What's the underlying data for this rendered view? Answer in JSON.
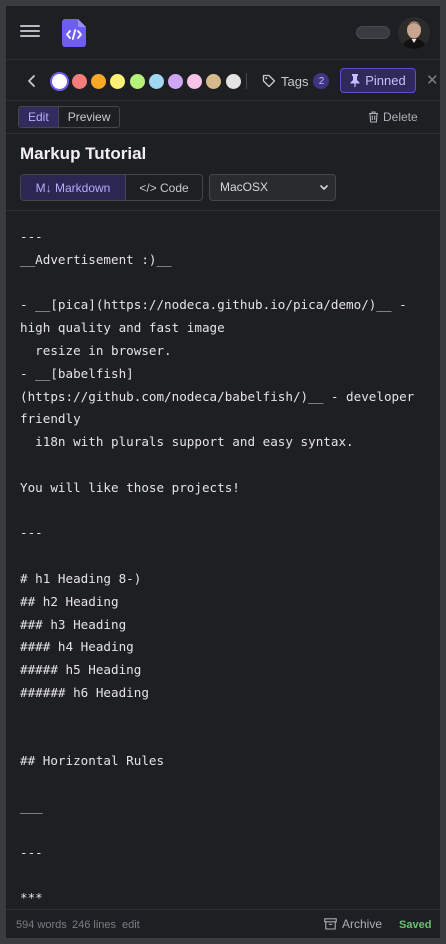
{
  "header": {
    "menu_icon": "hamburger-menu-icon",
    "logo_icon": "code-file-logo-icon",
    "avatar_icon": "user-avatar",
    "theme_toggle_icon": "toggle-switch"
  },
  "toolbar": {
    "back_icon": "chevron-left-icon",
    "colors": [
      "#ffffff",
      "#f47c7c",
      "#f9a825",
      "#fff176",
      "#b5f27a",
      "#9fd8f0",
      "#cfa6f5",
      "#f6c3e6",
      "#d7b98e",
      "#e4e4e4"
    ],
    "selected_color_index": 0,
    "tags_label": "Tags",
    "tags_count": "2",
    "pinned_label": "Pinned",
    "close_label": "✕"
  },
  "editbar": {
    "edit_label": "Edit",
    "preview_label": "Preview",
    "delete_label": "Delete"
  },
  "note": {
    "title": "Markup Tutorial",
    "markdown_label": "M↓ Markdown",
    "code_label": "</> Code",
    "language": "MacOSX"
  },
  "editor": {
    "content": "---\n__Advertisement :)__\n\n- __[pica](https://nodeca.github.io/pica/demo/)__ -\nhigh quality and fast image\n  resize in browser.\n- __[babelfish]\n(https://github.com/nodeca/babelfish/)__ - developer\nfriendly\n  i18n with plurals support and easy syntax.\n\nYou will like those projects!\n\n---\n\n# h1 Heading 8-)\n## h2 Heading\n### h3 Heading\n#### h4 Heading\n##### h5 Heading\n###### h6 Heading\n\n\n## Horizontal Rules\n\n___\n\n---\n\n***"
  },
  "status": {
    "words": "594 words",
    "lines": "246 lines",
    "mode": "edit",
    "archive_label": "Archive",
    "saved_label": "Saved"
  },
  "colors": {
    "accent": "#6d5df0",
    "background": "#1e1f22",
    "saved": "#6cc070"
  }
}
